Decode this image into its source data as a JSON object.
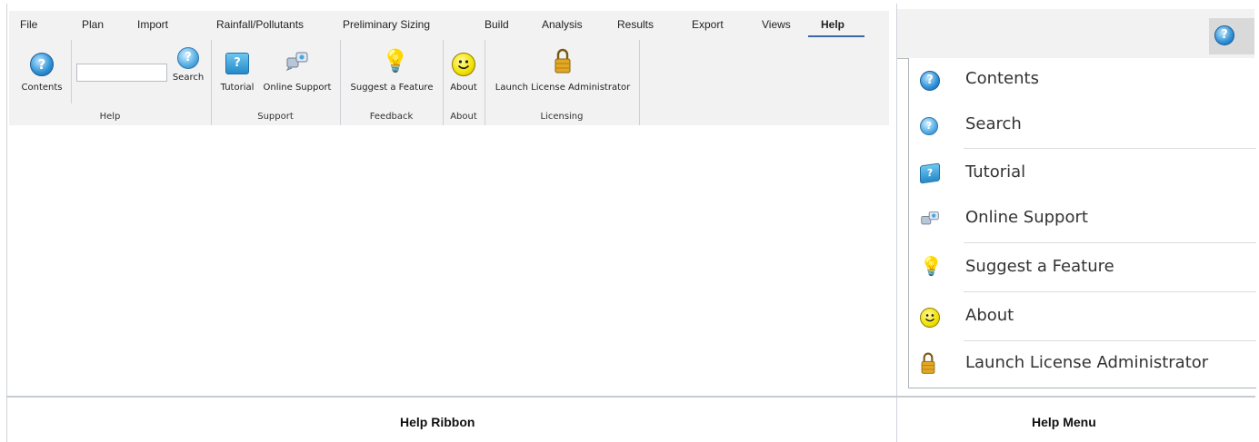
{
  "ribbon": {
    "tabs": [
      "File",
      "Plan",
      "Import",
      "Rainfall/Pollutants",
      "Preliminary Sizing",
      "Build",
      "Analysis",
      "Results",
      "Export",
      "Views",
      "Help"
    ],
    "active_tab": "Help",
    "buttons": {
      "contents": "Contents",
      "search": "Search",
      "tutorial": "Tutorial",
      "online_support": "Online Support",
      "suggest": "Suggest a Feature",
      "about": "About",
      "license": "Launch License Administrator"
    },
    "search_value": "",
    "groups": [
      "Help",
      "Support",
      "Feedback",
      "About",
      "Licensing"
    ]
  },
  "menu": {
    "items": [
      "Contents",
      "Search",
      "Tutorial",
      "Online Support",
      "Suggest a Feature",
      "About",
      "Launch License Administrator"
    ]
  },
  "captions": {
    "left": "Help Ribbon",
    "right": "Help Menu"
  },
  "icons": [
    "help-contents-icon",
    "help-search-icon",
    "tutorial-icon",
    "online-support-icon",
    "lightbulb-icon",
    "smiley-icon",
    "padlock-icon"
  ],
  "colors": {
    "active_tab_underline": "#3a66a8",
    "ribbon_bg": "#f2f2f2"
  }
}
